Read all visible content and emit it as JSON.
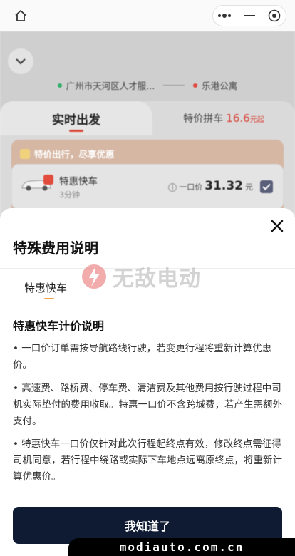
{
  "topbar": {
    "icons": {
      "home": "home-icon",
      "more": "more-dots-icon",
      "minimize": "minimize-icon",
      "close": "target-close-icon"
    }
  },
  "background": {
    "route": {
      "from": "广州市天河区人才服...",
      "to": "乐港公寓",
      "from_color": "#2fae6a",
      "to_color": "#e0463b"
    },
    "tabs": {
      "realtime": "实时出发",
      "carpool": "特价拼车",
      "carpool_price": "16.6",
      "carpool_unit": "元起"
    },
    "promo": {
      "label": "特价出行，尽享优惠"
    },
    "car": {
      "name": "特惠快车",
      "eta": "3分钟",
      "price_label": "一口价",
      "price": "31.32",
      "price_unit": "元",
      "info": "i"
    }
  },
  "sheet": {
    "title": "特殊费用说明",
    "tab": "特惠快车",
    "section_title": "特惠快车计价说明",
    "paragraphs": [
      "• 一口价订单需按导航路线行驶，若变更行程将重新计算优惠价。",
      "• 高速费、路桥费、停车费、清洁费及其他费用按行驶过程中司机实际垫付的费用收取。特惠一口价不含跨城费，若产生需额外支付。",
      "• 特惠快车一口价仅针对此次行程起终点有效，修改终点需征得司机同意，若行程中绕路或实际下车地点远离原终点，将重新计算优惠价。"
    ],
    "confirm_button": "我知道了",
    "watermark": "无敌电动"
  },
  "footer": {
    "text": "modiauto.com.cn"
  },
  "colors": {
    "accent_red": "#d9493a",
    "button_dark": "#0f1b33",
    "tab_underline": "#f0a04a"
  }
}
